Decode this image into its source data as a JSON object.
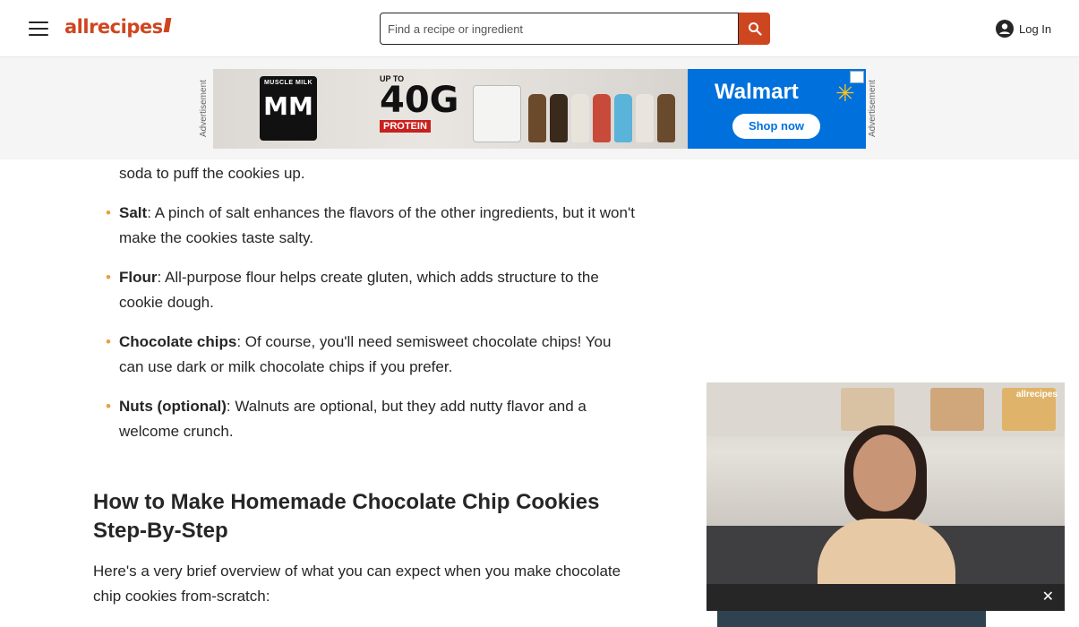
{
  "header": {
    "logo": "allrecipes",
    "search_placeholder": "Find a recipe or ingredient",
    "login_label": "Log In"
  },
  "ad": {
    "label_left": "Advertisement",
    "label_right": "Advertisement",
    "brand_left": "MUSCLE MILK",
    "promo_upto": "UP TO",
    "promo_amount": "40G",
    "promo_protein": "PROTEIN",
    "brand_right": "Walmart",
    "cta": "Shop now"
  },
  "article": {
    "ingredients": [
      {
        "name": "",
        "text": "soda to puff the cookies up."
      },
      {
        "name": "Salt",
        "text": ": A pinch of salt enhances the flavors of the other ingredients, but it won't make the cookies taste salty."
      },
      {
        "name": "Flour",
        "text": ": All-purpose flour helps create gluten, which adds structure to the cookie dough."
      },
      {
        "name": "Chocolate chips",
        "text": ": Of course, you'll need semisweet chocolate chips! You can use dark or milk chocolate chips if you prefer."
      },
      {
        "name": "Nuts (optional)",
        "text": ": Walnuts are optional, but they add nutty flavor and a welcome crunch."
      }
    ],
    "heading": "How to Make Homemade Chocolate Chip Cookies Step-By-Step",
    "intro": "Here's a very brief overview of what you can expect when you make chocolate chip cookies from-scratch:"
  },
  "video": {
    "logo": "allrecipes",
    "close": "✕"
  }
}
